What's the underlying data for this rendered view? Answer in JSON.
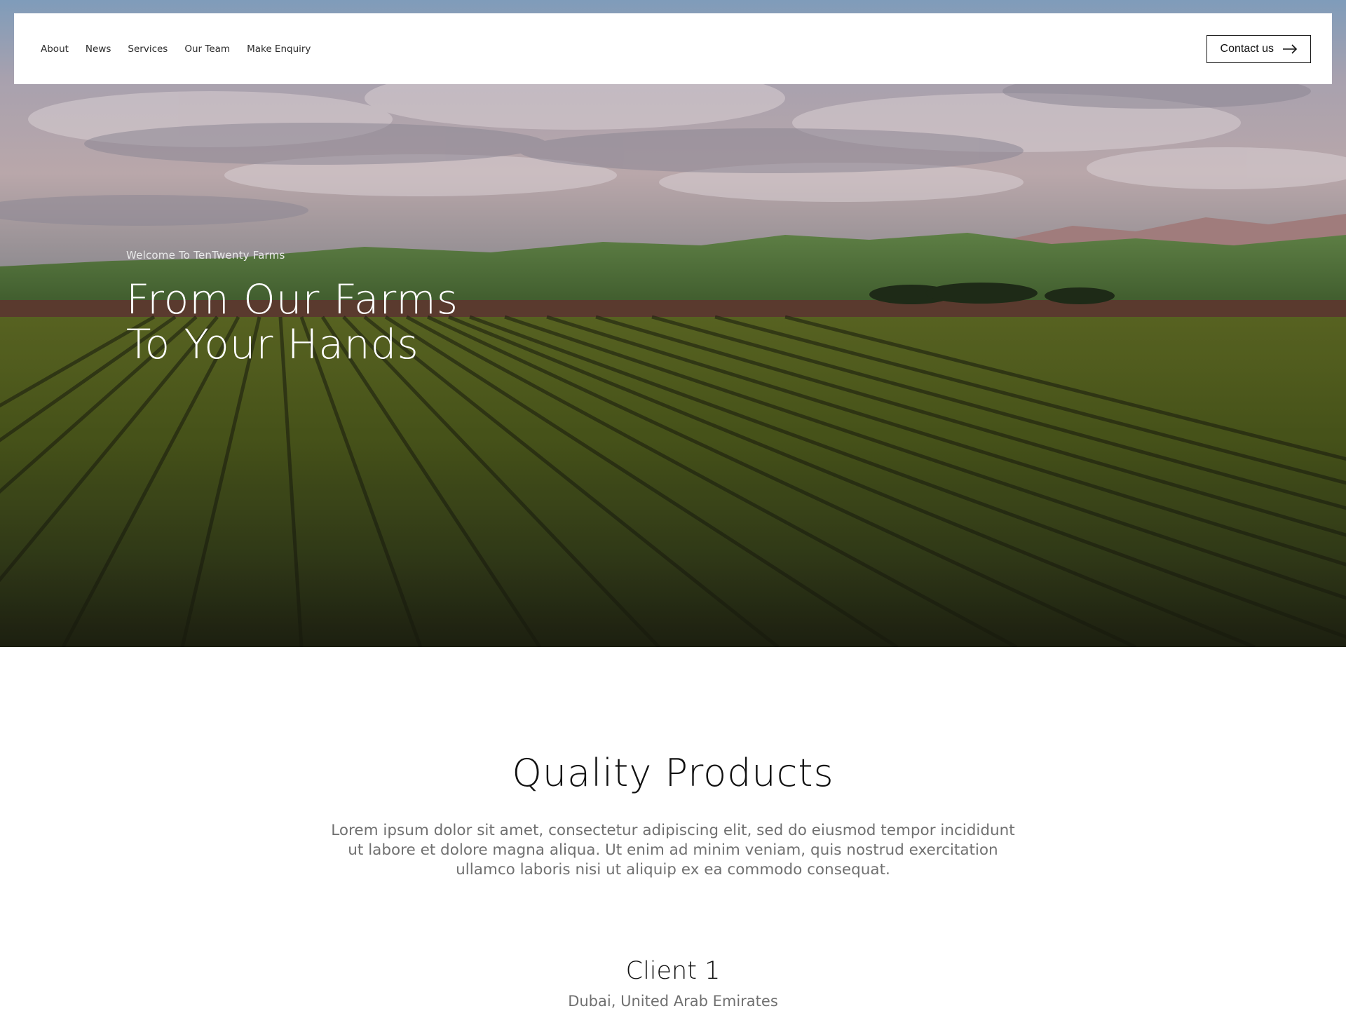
{
  "nav": {
    "links": [
      "About",
      "News",
      "Services",
      "Our Team",
      "Make Enquiry"
    ],
    "contact_label": "Contact us",
    "contact_icon": "arrow-right-icon"
  },
  "hero": {
    "welcome": "Welcome To TenTwenty Farms",
    "title_line1": "From Our Farms",
    "title_line2": "To Your Hands"
  },
  "section": {
    "title": "Quality Products",
    "description": "Lorem ipsum dolor sit amet, consectetur adipiscing elit, sed do eiusmod tempor incididunt ut labore et dolore magna aliqua. Ut enim ad minim veniam, quis nostrud exercitation ullamco laboris nisi ut aliquip ex ea commodo consequat."
  },
  "client": {
    "name": "Client 1",
    "location": "Dubai, United Arab Emirates"
  },
  "colors": {
    "accent": "#1a1a1a",
    "muted_text": "#707070",
    "field_green": "#4e5a1c"
  }
}
